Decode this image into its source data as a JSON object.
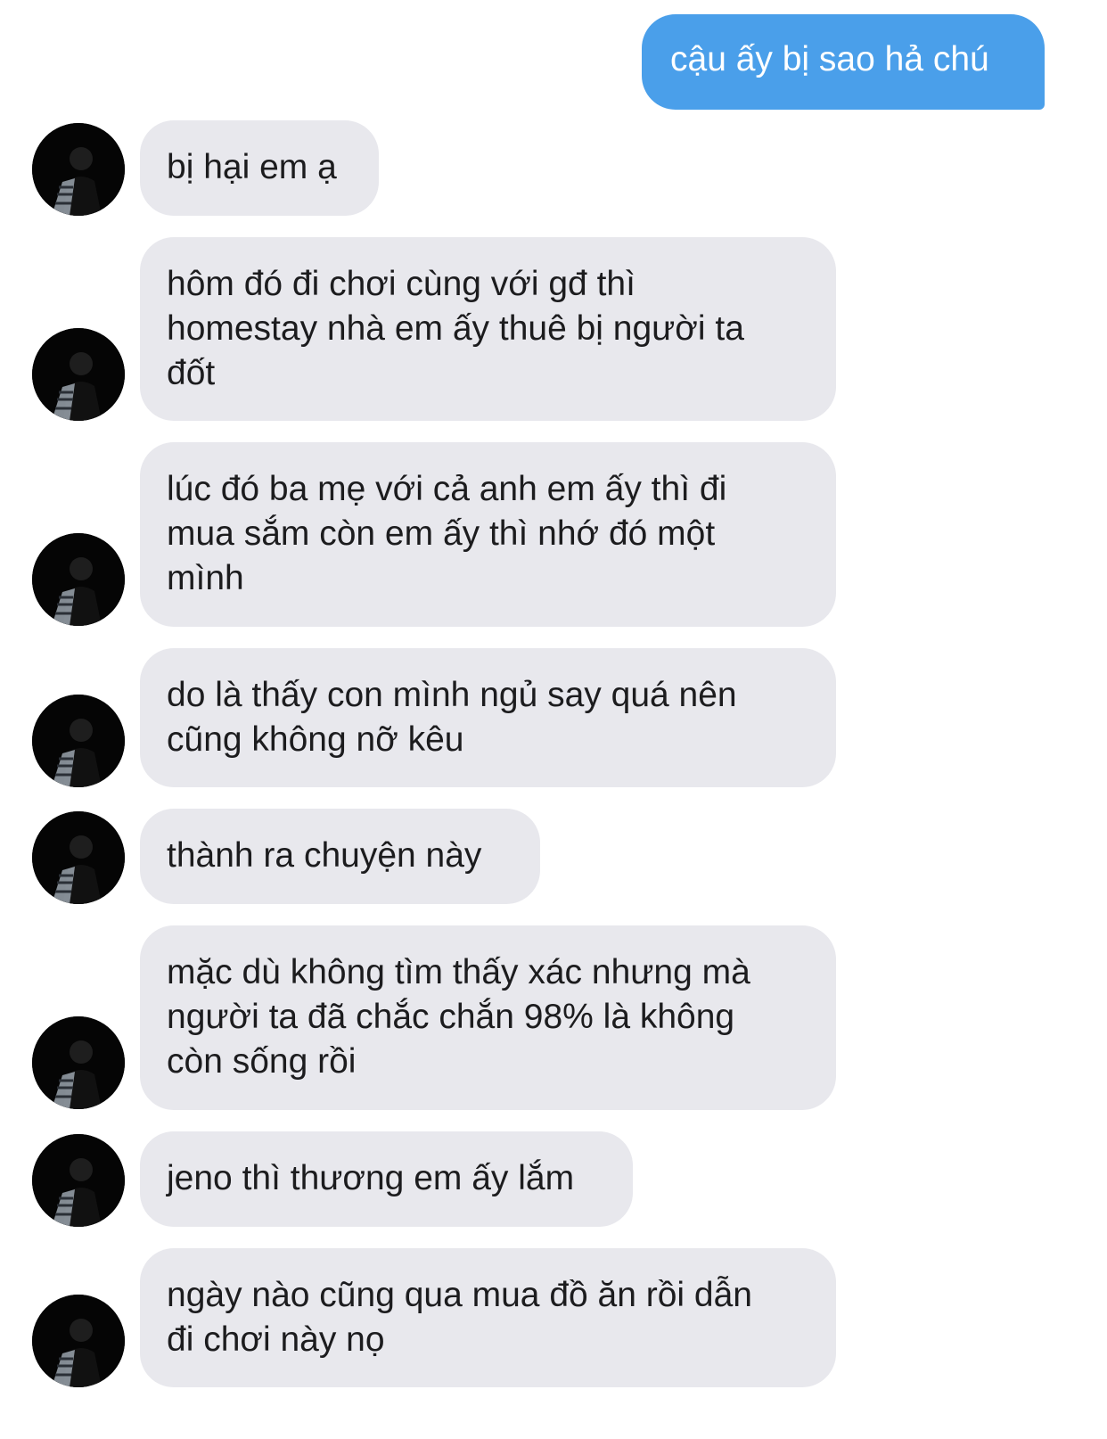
{
  "conversation": {
    "outgoing": [
      {
        "text": "cậu ấy bị sao hả chú"
      }
    ],
    "incoming": [
      {
        "lines": [
          "bị hại em ạ"
        ]
      },
      {
        "lines": [
          "hôm đó đi chơi cùng với gđ thì",
          "homestay nhà em ấy thuê bị người ta",
          "đốt"
        ]
      },
      {
        "lines": [
          "lúc đó ba mẹ với cả anh em ấy thì đi",
          "mua sắm còn em ấy thì nhớ đó một",
          "mình"
        ]
      },
      {
        "lines": [
          "do là thấy con mình ngủ say quá nên",
          "cũng không nỡ kêu"
        ]
      },
      {
        "lines": [
          "thành ra chuyện này"
        ]
      },
      {
        "lines": [
          "mặc dù không tìm thấy xác nhưng mà",
          "người ta đã chắc chắn 98% là không",
          "còn sống rồi"
        ]
      },
      {
        "lines": [
          "jeno thì thương em ấy lắm"
        ]
      },
      {
        "lines": [
          "ngày nào cũng qua mua đồ ăn rồi dẫn",
          "đi chơi này nọ"
        ]
      }
    ]
  },
  "colors": {
    "outgoing_bubble": "#4a9fea",
    "incoming_bubble": "#e8e8ed",
    "incoming_text": "#1c1c1e",
    "outgoing_text": "#ffffff"
  },
  "icons": {
    "avatar": "contact-avatar-icon"
  }
}
